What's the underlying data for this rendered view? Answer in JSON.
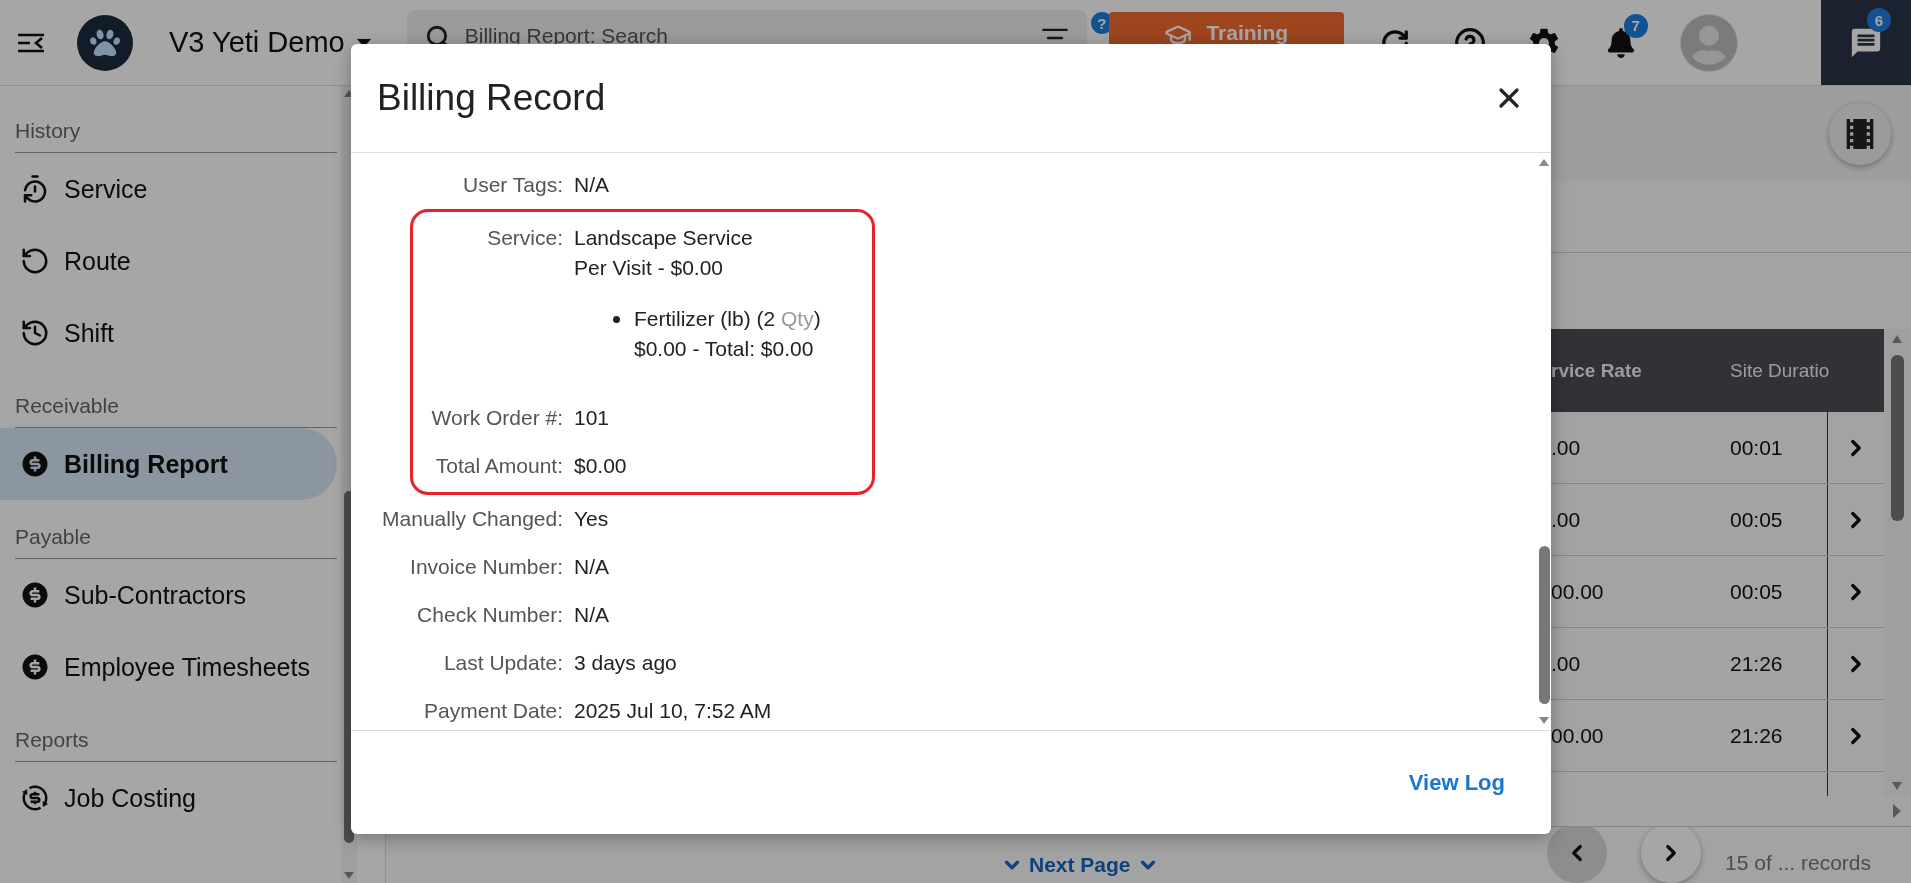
{
  "header": {
    "app_name": "V3 Yeti Demo",
    "search": {
      "placeholder": "Billing Report: Search"
    },
    "help_badge": "?",
    "training_button": "Training",
    "notifications_badge": "7",
    "messages_badge": "6"
  },
  "sidebar": {
    "sections": [
      {
        "title": "History",
        "items": [
          {
            "label": "Service",
            "selected": false
          },
          {
            "label": "Route",
            "selected": false
          },
          {
            "label": "Shift",
            "selected": false
          }
        ]
      },
      {
        "title": "Receivable",
        "items": [
          {
            "label": "Billing Report",
            "selected": true
          }
        ]
      },
      {
        "title": "Payable",
        "items": [
          {
            "label": "Sub-Contractors",
            "selected": false
          },
          {
            "label": "Employee Timesheets",
            "selected": false
          }
        ]
      },
      {
        "title": "Reports",
        "items": [
          {
            "label": "Job Costing",
            "selected": false
          }
        ]
      }
    ]
  },
  "table": {
    "columns": [
      "rvice Rate",
      "Site Duratio"
    ],
    "rows": [
      {
        "cells": [
          ".00",
          "00:01"
        ]
      },
      {
        "cells": [
          ".00",
          "00:05"
        ]
      },
      {
        "cells": [
          "00.00",
          "00:05"
        ]
      },
      {
        "cells": [
          ".00",
          "21:26"
        ]
      },
      {
        "cells": [
          "00.00",
          "21:26"
        ]
      }
    ]
  },
  "pagination": {
    "next_page": "Next Page",
    "records": "15 of ... records"
  },
  "modal": {
    "title": "Billing Record",
    "fields": [
      {
        "label": "User Tags:",
        "lines": [
          "N/A"
        ],
        "highlighted": false
      },
      {
        "label": "Service:",
        "lines": [
          "Landscape Service",
          "Per Visit - $0.00"
        ],
        "items": [
          {
            "parts": [
              {
                "text": "Fertilizer (lb) (2 ",
                "muted": false
              },
              {
                "text": "Qty",
                "muted": true
              },
              {
                "text": ")",
                "muted": false
              }
            ],
            "detail": "$0.00 - Total: $0.00"
          }
        ],
        "highlighted": true
      },
      {
        "label": "Work Order #:",
        "lines": [
          "101"
        ],
        "highlighted": true
      },
      {
        "label": "Total Amount:",
        "lines": [
          "$0.00"
        ],
        "highlighted": true
      },
      {
        "label": "Manually Changed:",
        "lines": [
          "Yes"
        ],
        "highlighted": false
      },
      {
        "label": "Invoice Number:",
        "lines": [
          "N/A"
        ],
        "highlighted": false
      },
      {
        "label": "Check Number:",
        "lines": [
          "N/A"
        ],
        "highlighted": false
      },
      {
        "label": "Last Update:",
        "lines": [
          "3 days ago"
        ],
        "highlighted": false
      },
      {
        "label": "Payment Date:",
        "lines": [
          "2025 Jul 10, 7:52 AM"
        ],
        "highlighted": false
      }
    ],
    "footer_link": "View Log"
  }
}
